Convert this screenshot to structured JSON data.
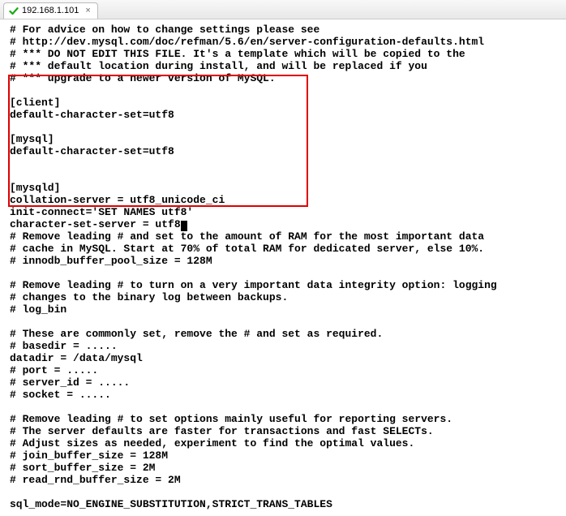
{
  "tab": {
    "title": "192.168.1.101",
    "close_glyph": "×"
  },
  "editor": {
    "lines": [
      "# For advice on how to change settings please see",
      "# http://dev.mysql.com/doc/refman/5.6/en/server-configuration-defaults.html",
      "# *** DO NOT EDIT THIS FILE. It's a template which will be copied to the",
      "# *** default location during install, and will be replaced if you",
      "# *** upgrade to a newer version of MySQL.",
      "",
      "[client]",
      "default-character-set=utf8",
      "",
      "[mysql]",
      "default-character-set=utf8",
      "",
      "",
      "[mysqld]",
      "collation-server = utf8_unicode_ci",
      "init-connect='SET NAMES utf8'",
      "character-set-server = utf8",
      "# Remove leading # and set to the amount of RAM for the most important data",
      "# cache in MySQL. Start at 70% of total RAM for dedicated server, else 10%.",
      "# innodb_buffer_pool_size = 128M",
      "",
      "# Remove leading # to turn on a very important data integrity option: logging",
      "# changes to the binary log between backups.",
      "# log_bin",
      "",
      "# These are commonly set, remove the # and set as required.",
      "# basedir = .....",
      "datadir = /data/mysql",
      "# port = .....",
      "# server_id = .....",
      "# socket = .....",
      "",
      "# Remove leading # to set options mainly useful for reporting servers.",
      "# The server defaults are faster for transactions and fast SELECTs.",
      "# Adjust sizes as needed, experiment to find the optimal values.",
      "# join_buffer_size = 128M",
      "# sort_buffer_size = 2M",
      "# read_rnd_buffer_size = 2M",
      "",
      "sql_mode=NO_ENGINE_SUBSTITUTION,STRICT_TRANS_TABLES"
    ],
    "cursor_line": 16
  }
}
